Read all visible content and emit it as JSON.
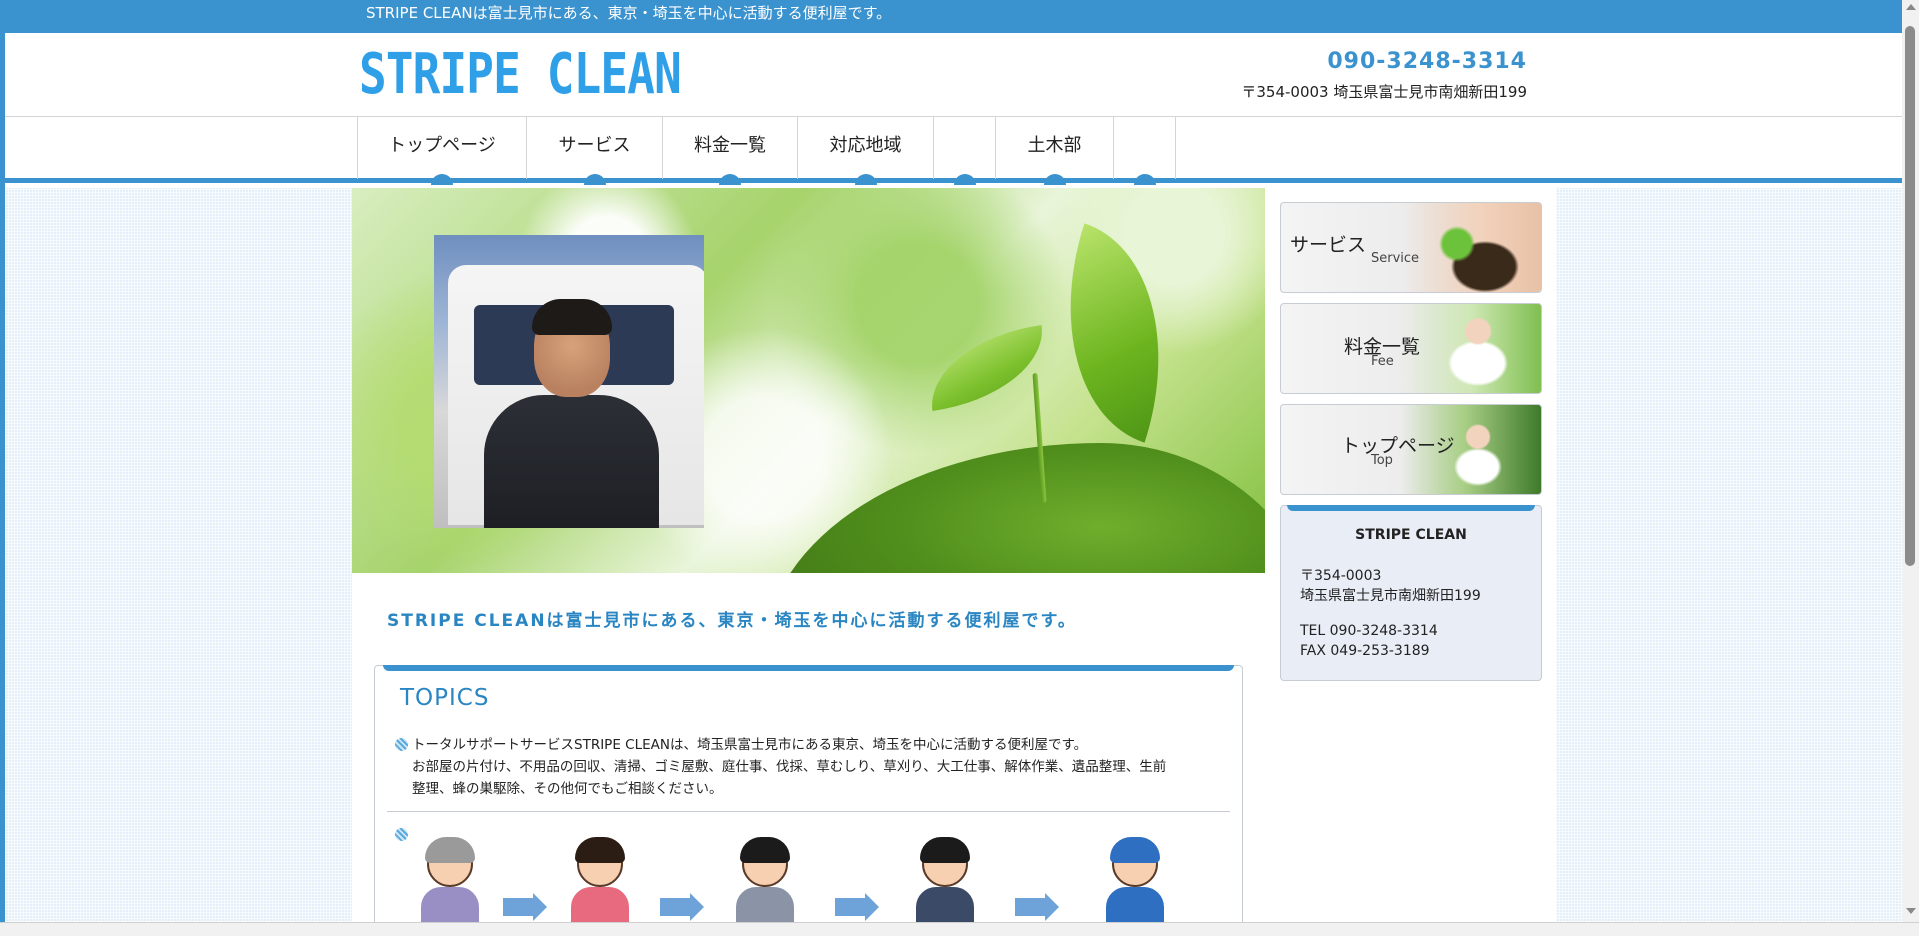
{
  "topbar": {
    "text": "STRIPE CLEANは富士見市にある、東京・埼玉を中心に活動する便利屋です。"
  },
  "header": {
    "logo": "STRIPE CLEAN",
    "tel": "090-3248-3314",
    "address": "〒354-0003 埼玉県富士見市南畑新田199"
  },
  "nav": {
    "items": [
      {
        "label": "トップページ"
      },
      {
        "label": "サービス"
      },
      {
        "label": "料金一覧"
      },
      {
        "label": "対応地域"
      },
      {
        "label": ""
      },
      {
        "label": "土木部"
      },
      {
        "label": ""
      }
    ]
  },
  "main": {
    "lead": "STRIPE CLEANは富士見市にある、東京・埼玉を中心に活動する便利屋です。",
    "topics": {
      "title": "TOPICS",
      "line1": "トータルサポートサービスSTRIPE CLEANは、埼玉県富士見市にある東京、埼玉を中心に活動する便利屋です。",
      "line2": "お部屋の片付け、不用品の回収、清掃、ゴミ屋敷、庭仕事、伐採、草むしり、草刈り、大工仕事、解体作業、遺品整理、生前",
      "line3": "整理、蜂の巣駆除、その他何でもご相談ください。"
    }
  },
  "sidebar": {
    "buttons": [
      {
        "jp": "サービス",
        "en": "Service"
      },
      {
        "jp": "料金一覧",
        "en": "Fee"
      },
      {
        "jp": "トップページ",
        "en": "Top"
      }
    ],
    "info": {
      "name": "STRIPE CLEAN",
      "postal": "〒354-0003",
      "address": "埼玉県富士見市南畑新田199",
      "tel": "TEL 090-3248-3314",
      "fax": "FAX 049-253-3189"
    }
  },
  "colors": {
    "brand": "#3a93cf",
    "logo": "#2f9fe8",
    "lead": "#2a86c2",
    "info_bg": "#e9edf6"
  },
  "icons": [
    "bullet-icon",
    "arrow-right-icon"
  ]
}
